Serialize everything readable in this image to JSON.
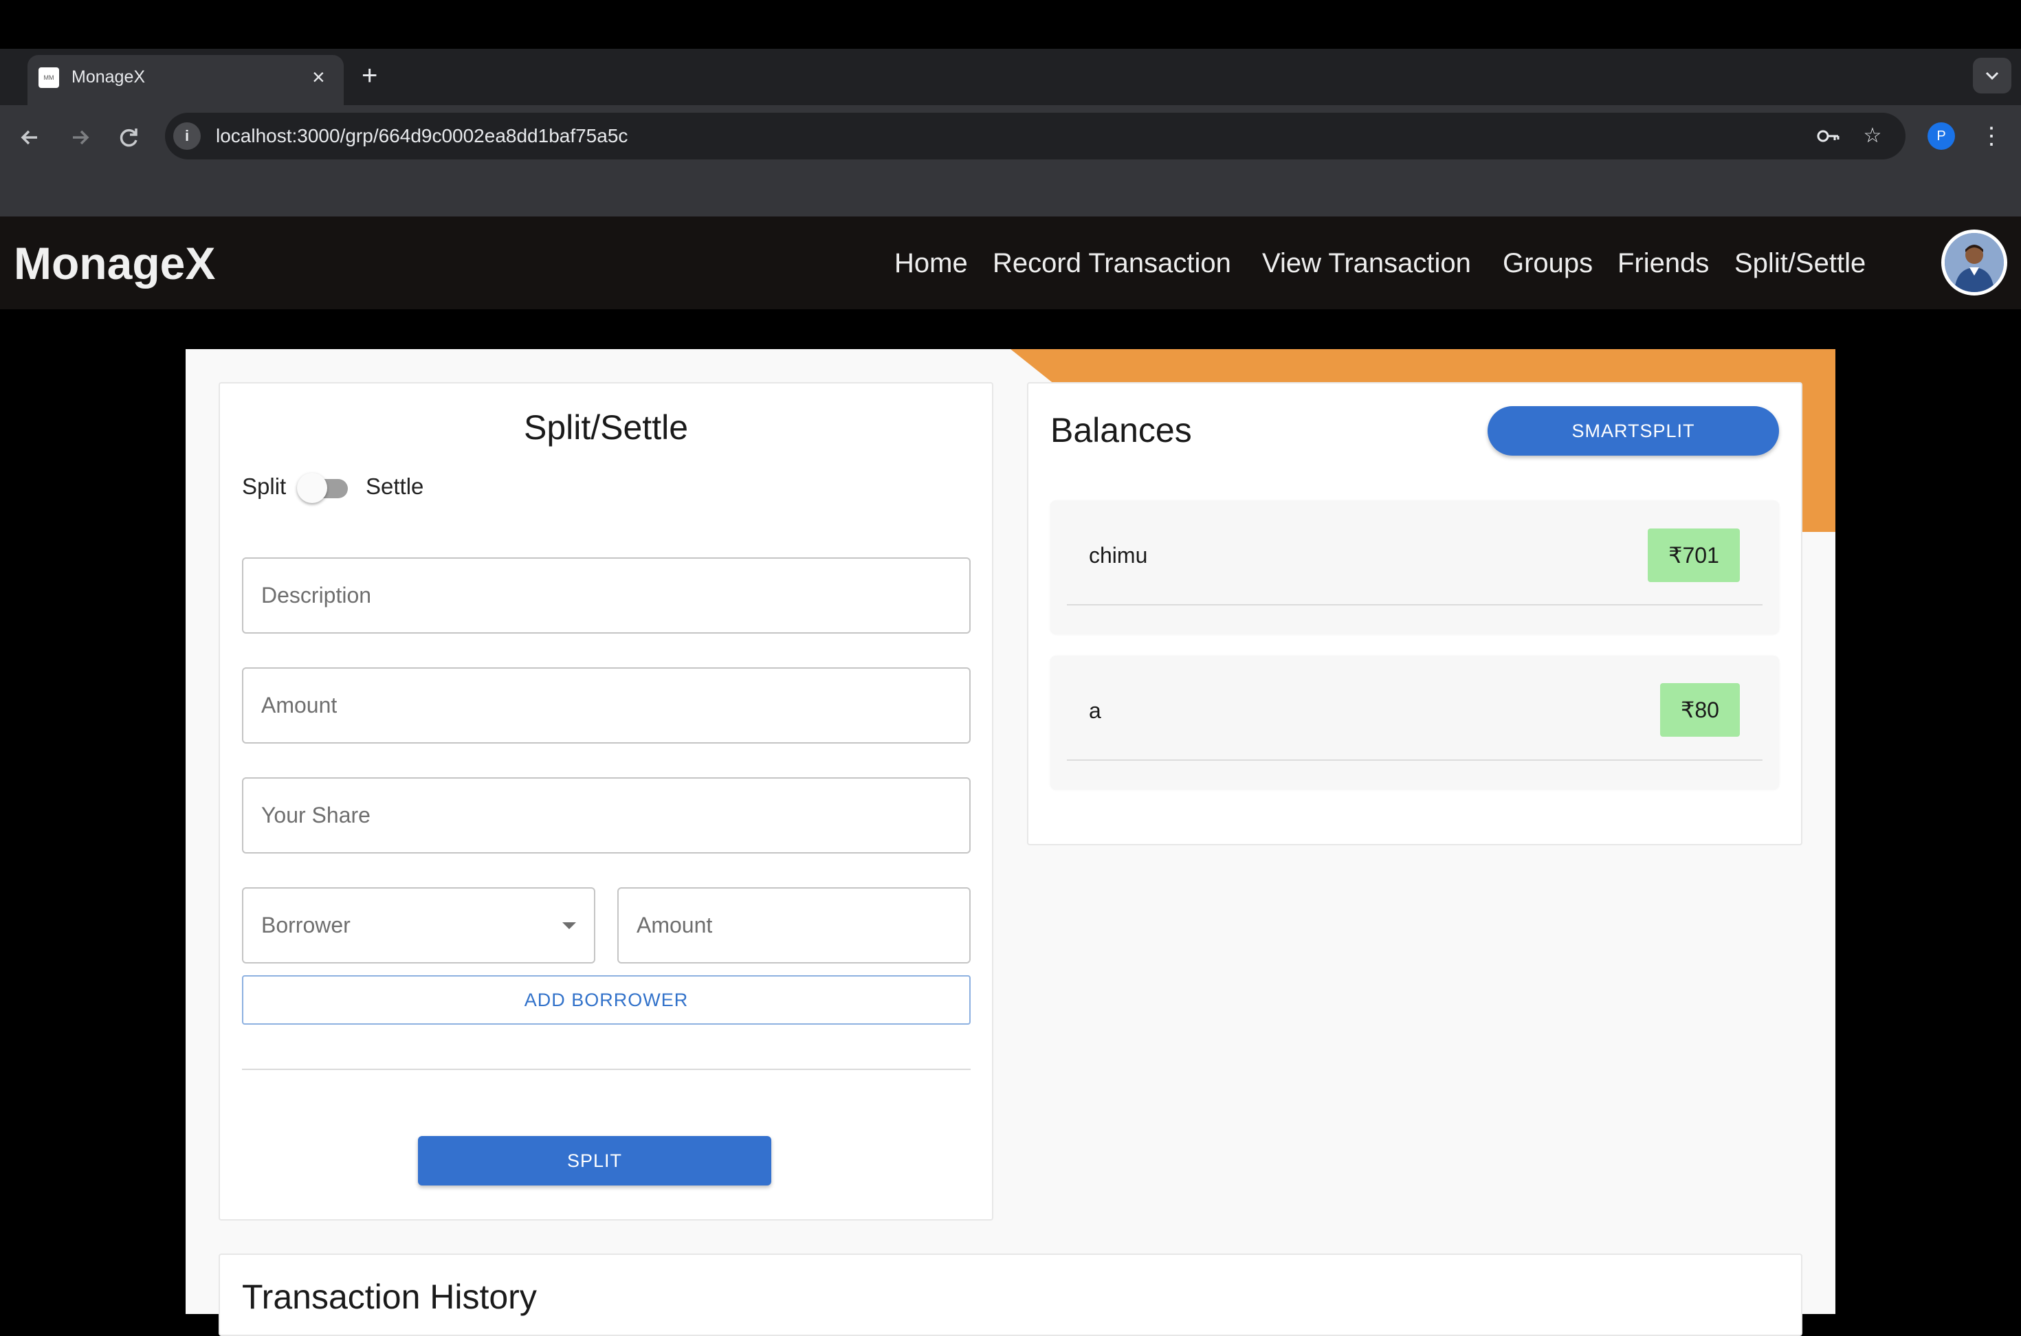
{
  "browser": {
    "tab_title": "MonageX",
    "favicon_text": "MM",
    "url": "localhost:3000/grp/664d9c0002ea8dd1baf75a5c",
    "profile_initial": "P"
  },
  "app": {
    "brand": "MonageX",
    "nav": [
      "Home",
      "Record Transaction",
      "View Transaction",
      "Groups",
      "Friends",
      "Split/Settle"
    ]
  },
  "split_form": {
    "title": "Split/Settle",
    "toggle_left": "Split",
    "toggle_right": "Settle",
    "toggle_on": false,
    "description_placeholder": "Description",
    "amount_placeholder": "Amount",
    "share_placeholder": "Your Share",
    "borrower_placeholder": "Borrower",
    "borrower_amount_placeholder": "Amount",
    "add_borrower_label": "ADD BORROWER",
    "submit_label": "SPLIT"
  },
  "balances": {
    "title": "Balances",
    "smartsplit_label": "SMARTSPLIT",
    "items": [
      {
        "name": "chimu",
        "amount": "₹701"
      },
      {
        "name": "a",
        "amount": "₹80"
      }
    ]
  },
  "history": {
    "title": "Transaction History"
  },
  "colors": {
    "primary": "#3471ce",
    "accent_orange": "#ec9942",
    "balance_positive": "#a5e8a1",
    "header_bg": "#151211"
  }
}
